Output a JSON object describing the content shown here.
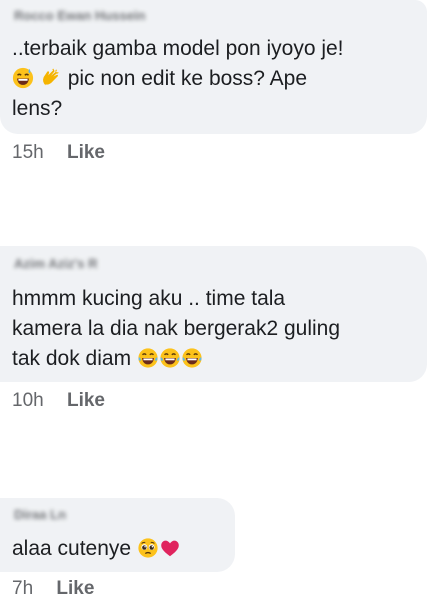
{
  "comments": [
    {
      "author": "Rocco Ewan Hussein",
      "line1": "..terbaik gamba model pon iyoyo je!",
      "line2": "pic non edit ke boss? Ape",
      "line3": "lens?",
      "time": "15h",
      "like": "Like",
      "icons": [
        "grinning-sweat-emoji",
        "clapping-hands-emoji"
      ]
    },
    {
      "author": "Azim Aziz's R",
      "line1": "hmmm kucing aku .. time tala",
      "line2": "kamera la dia nak bergerak2 guling",
      "line3": "tak dok diam",
      "time": "10h",
      "like": "Like",
      "icons": [
        "tears-of-joy-emoji",
        "tears-of-joy-emoji",
        "tears-of-joy-emoji"
      ]
    },
    {
      "author": "Diraa Ln",
      "line1": "alaa cutenye",
      "time": "7h",
      "like": "Like",
      "icons": [
        "pleading-face-emoji",
        "red-heart-emoji"
      ]
    }
  ],
  "colors": {
    "bubble": "#f0f2f5",
    "text": "#1c1e21",
    "meta": "#65676b",
    "emoji_yellow": "#fcc21b",
    "heart": "#e0245e"
  }
}
